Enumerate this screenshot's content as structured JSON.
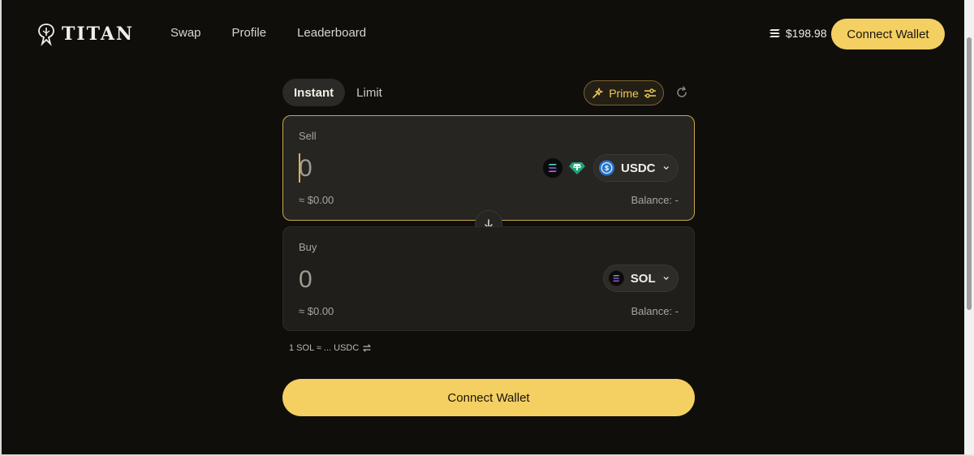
{
  "header": {
    "logo_text": "TITAN",
    "nav": [
      "Swap",
      "Profile",
      "Leaderboard"
    ],
    "sol_price": "$198.98",
    "connect_label": "Connect Wallet"
  },
  "mode_tabs": {
    "instant": "Instant",
    "limit": "Limit",
    "active": "Instant"
  },
  "prime_label": "Prime",
  "sell": {
    "label": "Sell",
    "amount": "0",
    "usd_value": "≈ $0.00",
    "balance": "Balance: -",
    "token": "USDC",
    "quick_tokens": [
      "SOL",
      "USDT"
    ]
  },
  "buy": {
    "label": "Buy",
    "amount": "0",
    "usd_value": "≈ $0.00",
    "balance": "Balance: -",
    "token": "SOL"
  },
  "rate_text": "1 SOL ≈ ... USDC",
  "main_connect_label": "Connect Wallet",
  "colors": {
    "accent": "#f4cf62",
    "background": "#100e0b",
    "card": "#262521",
    "usdc": "#2775ca",
    "usdt": "#26a17b"
  }
}
